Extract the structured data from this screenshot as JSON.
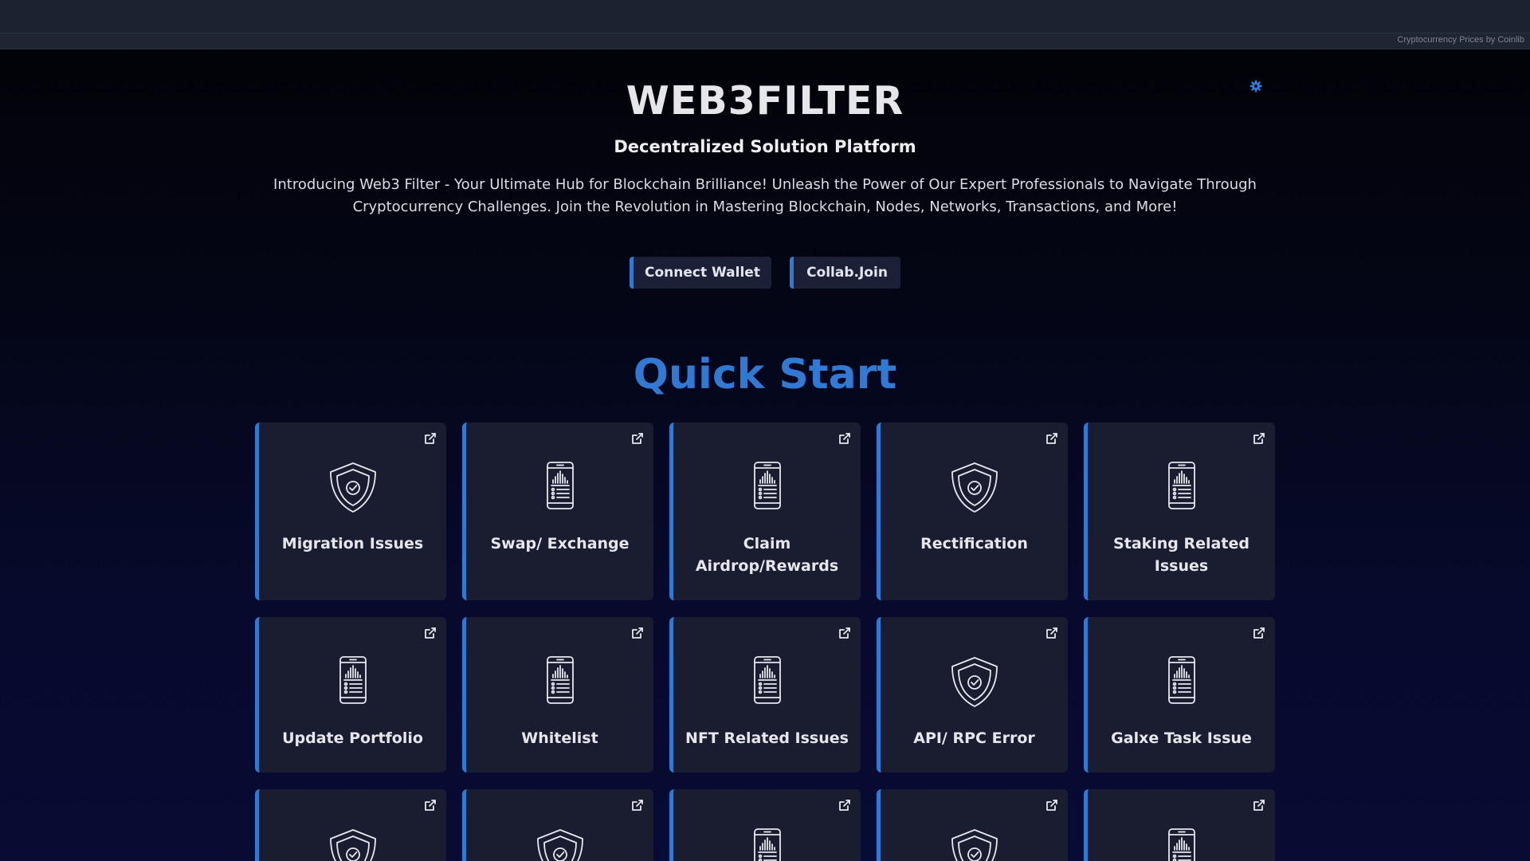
{
  "ticker": {
    "credit": "Cryptocurrency Prices by Coinlib"
  },
  "header": {
    "title": "WEB3FILTER",
    "subtitle": "Decentralized Solution Platform",
    "intro": "Introducing Web3 Filter - Your Ultimate Hub for Blockchain Brilliance! Unleash the Power of Our Expert Professionals to Navigate Through Cryptocurrency Challenges. Join the Revolution in Mastering Blockchain, Nodes, Networks, Transactions, and More!",
    "settings_icon": "gear-icon"
  },
  "buttons": {
    "connect": "Connect Wallet",
    "collab": "Collab.Join"
  },
  "quick_start": {
    "title": "Quick Start",
    "accent_color": "#2f7ad4",
    "cards": [
      {
        "label": "Migration Issues",
        "icon": "shield-check-icon"
      },
      {
        "label": "Swap/ Exchange",
        "icon": "phone-chart-icon"
      },
      {
        "label": "Claim Airdrop/Rewards",
        "icon": "phone-chart-icon"
      },
      {
        "label": "Rectification",
        "icon": "shield-check-icon"
      },
      {
        "label": "Staking Related Issues",
        "icon": "phone-chart-icon"
      },
      {
        "label": "Update Portfolio",
        "icon": "phone-chart-icon"
      },
      {
        "label": "Whitelist",
        "icon": "phone-chart-icon"
      },
      {
        "label": "NFT Related Issues",
        "icon": "phone-chart-icon"
      },
      {
        "label": "API/ RPC Error",
        "icon": "shield-check-icon"
      },
      {
        "label": "Galxe Task Issue",
        "icon": "phone-chart-icon"
      },
      {
        "label": "",
        "icon": "shield-check-icon"
      },
      {
        "label": "",
        "icon": "shield-check-icon"
      },
      {
        "label": "",
        "icon": "phone-chart-icon"
      },
      {
        "label": "",
        "icon": "shield-check-icon"
      },
      {
        "label": "",
        "icon": "phone-chart-icon"
      }
    ]
  }
}
